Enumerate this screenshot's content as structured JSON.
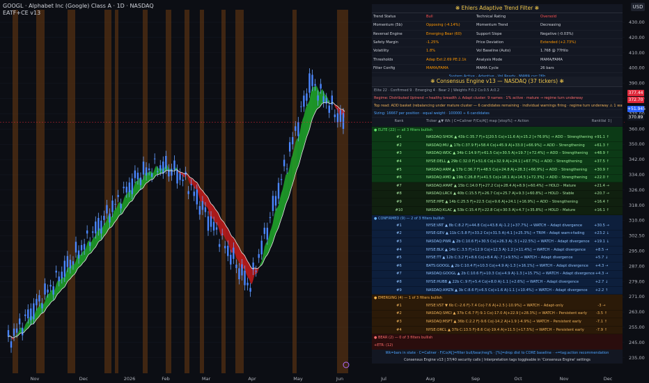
{
  "header": {
    "symbol_line": "GOOGL · Alphabet Inc (Google) Class A · 1D · NASDAQ",
    "indicator": "EATF+CE v13",
    "currency": "USD"
  },
  "price_axis": [
    "430.00",
    "420.00",
    "410.00",
    "400.00",
    "390.00",
    "380.00",
    "370.00",
    "360.00",
    "350.00",
    "342.00",
    "334.00",
    "326.00",
    "318.00",
    "310.00",
    "302.50",
    "295.00",
    "287.00",
    "279.00",
    "271.00",
    "263.00",
    "255.00",
    "245.00",
    "235.00"
  ],
  "price_tags": [
    {
      "text": "377.44",
      "color": "#e0283a"
    },
    {
      "text": "372.70",
      "color": "#e0283a"
    },
    {
      "text": "+51.945",
      "color": "#2962ff"
    },
    {
      "text": "370.89",
      "color": "#131722"
    }
  ],
  "time_axis": [
    "Nov",
    "Dec",
    "2026",
    "Feb",
    "Mar",
    "Apr",
    "May",
    "Jun",
    "Jul",
    "Aug",
    "Sep",
    "Oct",
    "Nov",
    "Dec"
  ],
  "trend_filter": {
    "title": "❋ Ehlers Adaptive Trend Filter ❋",
    "rows": [
      {
        "l1": "Trend Status",
        "v1": "Bull",
        "v1c": "#ff5252",
        "l2": "Technical Rating",
        "v2": "Oversold",
        "v2c": "#ff5252"
      },
      {
        "l1": "Momentum (5b)",
        "v1": "Opposing (-4.14%)",
        "v1c": "#ff9800",
        "l2": "Momentum Trend",
        "v2": "Decreasing",
        "v2c": "#d1d4dc"
      },
      {
        "l1": "Reversal Engine",
        "v1": "Emerging Bear (60)",
        "v1c": "#ff9800",
        "l2": "Support Slope",
        "v2": "Negative (-0.03%)",
        "v2c": "#d1d4dc"
      },
      {
        "l1": "Safety Margin",
        "v1": "-1.25%",
        "v1c": "#ff9800",
        "l2": "Price Deviation",
        "v2": "Extended (+2.73%)",
        "v2c": "#ff9800"
      },
      {
        "l1": "Volatility",
        "v1": "1.8%",
        "v1c": "#ff9800",
        "l2": "Vol Baseline (Auto)",
        "v2": "1.768 @ 77Hilo",
        "v2c": "#d1d4dc"
      },
      {
        "l1": "Thresholds",
        "v1": "Adap Ext:2.69 PE:2.1k",
        "v1c": "#ff9800",
        "l2": "Analysis Mode",
        "v2": "MAMA/FAMA",
        "v2c": "#d1d4dc"
      },
      {
        "l1": "Filter Config",
        "v1": "MAMA/FAMA",
        "v1c": "#ff9800",
        "l2": "MAMA Cycle",
        "v2": "26 bars",
        "v2c": "#d1d4dc"
      }
    ],
    "footer": "System Active · Adaptive · Vol Ready · MAMA cyc:26b"
  },
  "consensus": {
    "title": "❋ Consensus Engine v13 — NASDAQ (37 tickers) ❋",
    "summary": "Elite 22  ·  Confirmed 9  ·  Emerging 4  ·  Bear 2  |  Weights F:0.2 Co:0.5 A:0.2",
    "regime": "Regime: Distributed Uptrend → healthy breadth  ⚠ Adapt cluster: 9 names · 1% active · mature → regime turn underway",
    "top_read": "Top read: ADD basket (rebalancing under mature cluster — 6 candidates remaining · individual warnings firing · regime turn underway  ⚠ 1 warning → check Confirmed tier",
    "sizing": "Sizing: 16667 per position · equal weight · 100000 ÷ 6 candidates",
    "col_headers": {
      "rank": "Rank",
      "ticker": "Ticker ▲▼ Wk  |  C=Caliner  F/Co/A[] map  [stop%]  →  Action",
      "score": "RankVal ↕|"
    },
    "elite_label": "● ELITE (22) — all 3 filters bullish",
    "elite": [
      {
        "rank": "#1",
        "text": "NASDAQ:SHOK ▲ 43b  C:35.7  F|+1[20.5 Co|+11.6 A|+15.2  [+76.9%]  →  ADD – Strengthening",
        "score": "+91.1 ↑",
        "style": "g"
      },
      {
        "rank": "#2",
        "text": "NASDAQ:MU ▲ 17b  C:37.9  F|+58.4 Co|+45.9 A|+33.0  [+66.9%]  →  ADD – Strengthening",
        "score": "+61.3 ↑",
        "style": "g"
      },
      {
        "rank": "#3",
        "text": "NASDAQ:WDC ▲ 34b  C:14.9  F|+61.5 Co|+30.5 A|+19.7  [+72.4%]  →  ADD – Strengthening",
        "score": "+48.9 ↑",
        "style": "g"
      },
      {
        "rank": "#4",
        "text": "NYSE:DELL ▲ 29b  C:32.0  F|+51.6 Co|+32.9 A|+24.1  [+67.7%]  →  ADD – Strengthening",
        "score": "+37.5 ↑",
        "style": "g"
      },
      {
        "rank": "#5",
        "text": "NASDAQ:ARM ▲ 17b  C:36.7  F|+48.5 Co|+24.8 A|+28.3  [+66.9%]  →  ADD – Strengthening",
        "score": "+30.9 ↑",
        "style": "g"
      },
      {
        "rank": "#6",
        "text": "NASDAQ:AMD ▲ 19b  C:26.8  F|+41.5 Co|+18.1 A|+14.5  [+72.3%]  →  ADD – Strengthening",
        "score": "+22.0 ↑",
        "style": "g"
      },
      {
        "rank": "#7",
        "text": "NASDAQ:AMAT ▲ 15b  C:14.0  F|+27.2 Co|+28.4 A|+8.9  [+60.4%]  →  HOLD – Mature",
        "score": "+21.4 →",
        "style": "gd"
      },
      {
        "rank": "#8",
        "text": "NASDAQ:LRCX ▲ 40b  C:15.5  F|+26.7 Co|+25.7 A|+9.3  [+60.8%]  →  HOLD – Stable",
        "score": "+20.7 →",
        "style": "gd"
      },
      {
        "rank": "#9",
        "text": "NYSE:HPE ▲ 14b  C:25.5  F|+22.5 Co|+9.6 A|+24.1  [+16.9%]  →  ADD – Strengthening",
        "score": "+16.4 ↑",
        "style": "gd"
      },
      {
        "rank": "#10",
        "text": "NASDAQ:KLAC ▲ 53b  C:15.4  F|+22.8 Co|+30.5 A|+4.7  [+35.8%]  →  HOLD – Mature",
        "score": "+16.1 ↑",
        "style": "gd"
      }
    ],
    "confirmed_label": "● CONFIRMED (9) — 2 of 3 filters bullish",
    "confirmed": [
      {
        "rank": "#1",
        "text": "NYSE:VRT ▲ 8b  C:8.2  F|+44.8 Co|+43.8 A|-1.2  [+37.7%]  →  WATCH – Adapt divergence",
        "score": "+30.5 →",
        "style": "b"
      },
      {
        "rank": "#2",
        "text": "NYSE:GEV ▲ 11b  C:5.8  F|+33.2 Co|+31.5 A|-4.1  [+25.3%]  →  TRIM – Adapt warn+fading",
        "score": "+23.2 ↓",
        "style": "b"
      },
      {
        "rank": "#3",
        "text": "NASDAQ:PWR ▲ 2b  C:10.6  F|+30.5 Co|+26.3 A|-.5  [+22.5%]  →  WATCH – Adapt divergence",
        "score": "+19.1 ↓",
        "style": "b"
      },
      {
        "rank": "#4",
        "text": "NYSE:BLK ▲ 14b  C:.3.5  F|+12.9 Co|+12.5 A|-1.2  [+11.4%]  →  WATCH – Adapt divergence",
        "score": "+8.5 →",
        "style": "b"
      },
      {
        "rank": "#5",
        "text": "NYSE:TT ▲ 12b  C:3.2  F|+8.6 Co|+8.4 A|-.7  [+9.5%]  →  WATCH – Adapt divergence",
        "score": "+5.7 ↓",
        "style": "b"
      },
      {
        "rank": "#6",
        "text": "BATS:GOOGL ▲ 2b  C:10.4  F|+10.3 Co|+4.9 A|-1.3  [+16.1%]  →  WATCH – Adapt divergence",
        "score": "+4.3 →",
        "style": "b"
      },
      {
        "rank": "#7",
        "text": "NASDAQ:GOOGL ▲ 2b  C:10.6  F|+10.3 Co|+4.9 A|-1.3  [+15.7%]  →  WATCH – Adapt divergence",
        "score": "+4.3 →",
        "style": "b"
      },
      {
        "rank": "#8",
        "text": "NYSE:HUBB ▲ 22b  C:.9  F|+5.4 Co|+8.0 A|-1.1  [+2.6%]  →  WATCH – Adapt divergence",
        "score": "+2.7 ↓",
        "style": "b"
      },
      {
        "rank": "#9",
        "text": "NASDAQ:AMZN ▲ 3b  C:8.6  F|+6.5 Co|+1.6 A|-1.1  [+10.4%]  →  WATCH – Adapt divergence",
        "score": "+2.2 ↑",
        "style": "b"
      }
    ],
    "emerging_label": "● EMERGING (4) — 1 of 3 filters bullish",
    "emerging": [
      {
        "rank": "#1",
        "text": "NYSE:VST ▼ 6b  C:-2.6  F|-7.4 Co|-7.6 A|+2.5  [-10.9%]  →  WATCH – Adapt-only",
        "score": "-3 →",
        "style": "o"
      },
      {
        "rank": "#2",
        "text": "NASDAQ:SMCI ▲ 37b  C:6.7  F|-9.1 Co|-17.0 A|+22.9  [+28.3%]  →  WATCH – Persistent early",
        "score": "-3.5 ↑",
        "style": "o"
      },
      {
        "rank": "#3",
        "text": "NASDAQ:MSFT ▲ 36b  C:2.2  F|-9.6 Co|-14.2 A|+1.9  [-4.9%]  →  WATCH – Persistent early",
        "score": "-7.1 ↑",
        "style": "o"
      },
      {
        "rank": "#4",
        "text": "NYSE:ORCL ▲ 37b  C:13.5  F|-8.6 Co|-19.4 A|+11.5  [+17.5%]  →  WATCH – Persistent early",
        "score": "-7.9 ↑",
        "style": "o"
      }
    ],
    "bear_label": "● BEAR (2) — 0 of 3 filters bullish",
    "bear_note": "+ETR: (12)",
    "footer1": "Wk=bars in state · C=Caliner · F/Co/A[]=filter bull/bear/neg% · [%]=drop dist to CORE baseline · →=tag:action recommendation",
    "footer2": "Consensus Engine v13 | 37/40 security calls | Interpretation tags toggleable in 'Consensus Engine' settings"
  }
}
